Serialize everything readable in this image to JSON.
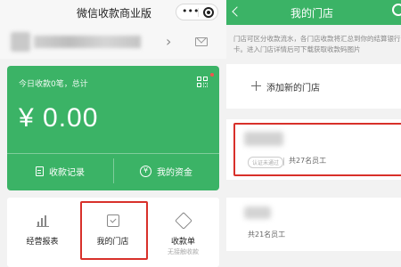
{
  "left": {
    "title": "微信收款商业版",
    "capsule_dots": "•••",
    "today_summary": "今日收款0笔，总计",
    "amount": "¥ 0.00",
    "buttons": {
      "records": "收款记录",
      "funds": "我的资金"
    },
    "grid": [
      {
        "label": "经营报表",
        "sub": ""
      },
      {
        "label": "我的门店",
        "sub": ""
      },
      {
        "label": "收款单",
        "sub": "无接触收款"
      }
    ],
    "icons": {
      "chevron": "›",
      "yen_glyph": "¥"
    }
  },
  "right": {
    "title": "我的门店",
    "description": "门店可区分收款流水，各门店收款将汇总到你的结算银行卡。进入门店详情后可下载获取收款码图片",
    "add_store": "添加新的门店",
    "stores": [
      {
        "badge": "认证未通过",
        "employees": "共27名员工"
      },
      {
        "badge": "",
        "employees": "共21名员工"
      }
    ]
  },
  "colors": {
    "brand_green": "#3bb366",
    "highlight_red": "#d8302a"
  }
}
